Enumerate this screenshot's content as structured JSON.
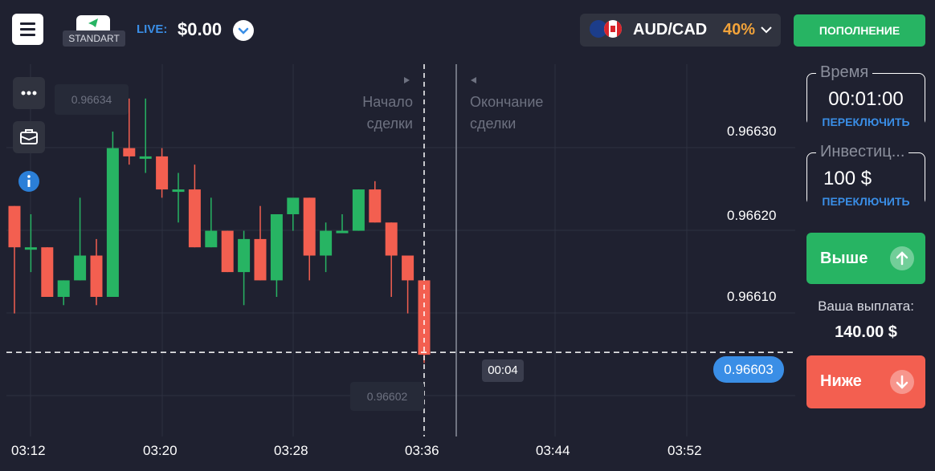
{
  "header": {
    "account_type": "STANDART",
    "live_label": "LIVE:",
    "balance": "$0.00",
    "asset": {
      "pair": "AUD/CAD",
      "payout_percent": "40%"
    },
    "deposit_label": "ПОПОЛНЕНИЕ"
  },
  "chart": {
    "price_labels": [
      "0.96630",
      "0.96620",
      "0.96610"
    ],
    "time_labels": [
      "03:12",
      "03:20",
      "03:28",
      "03:36",
      "03:44",
      "03:52"
    ],
    "high_marker": "0.96634",
    "low_marker": "0.96602",
    "current_price": "0.96603",
    "timer": "00:04",
    "trade_start_label": "Начало сделки",
    "trade_end_label": "Окончание сделки",
    "colors": {
      "up": "#27b463",
      "down": "#f35f50"
    },
    "candles": [
      {
        "o": 0.96621,
        "h": 0.96621,
        "l": 0.96608,
        "c": 0.96616
      },
      {
        "o": 0.96616,
        "h": 0.9662,
        "l": 0.96613,
        "c": 0.96616
      },
      {
        "o": 0.96616,
        "h": 0.96616,
        "l": 0.9661,
        "c": 0.9661
      },
      {
        "o": 0.9661,
        "h": 0.96612,
        "l": 0.96609,
        "c": 0.96612
      },
      {
        "o": 0.96612,
        "h": 0.96622,
        "l": 0.96612,
        "c": 0.96615
      },
      {
        "o": 0.96615,
        "h": 0.96617,
        "l": 0.96609,
        "c": 0.9661
      },
      {
        "o": 0.9661,
        "h": 0.9663,
        "l": 0.9661,
        "c": 0.96628
      },
      {
        "o": 0.96628,
        "h": 0.96634,
        "l": 0.96626,
        "c": 0.96627
      },
      {
        "o": 0.96627,
        "h": 0.96634,
        "l": 0.96625,
        "c": 0.96627
      },
      {
        "o": 0.96627,
        "h": 0.96628,
        "l": 0.96622,
        "c": 0.96623
      },
      {
        "o": 0.96623,
        "h": 0.96625,
        "l": 0.96619,
        "c": 0.96623
      },
      {
        "o": 0.96623,
        "h": 0.96626,
        "l": 0.96616,
        "c": 0.96616
      },
      {
        "o": 0.96616,
        "h": 0.96622,
        "l": 0.96616,
        "c": 0.96618
      },
      {
        "o": 0.96618,
        "h": 0.96618,
        "l": 0.96613,
        "c": 0.96613
      },
      {
        "o": 0.96613,
        "h": 0.96618,
        "l": 0.96609,
        "c": 0.96617
      },
      {
        "o": 0.96617,
        "h": 0.96621,
        "l": 0.96612,
        "c": 0.96612
      },
      {
        "o": 0.96612,
        "h": 0.9662,
        "l": 0.9661,
        "c": 0.9662
      },
      {
        "o": 0.9662,
        "h": 0.9662,
        "l": 0.96618,
        "c": 0.96622
      },
      {
        "o": 0.96622,
        "h": 0.96622,
        "l": 0.96612,
        "c": 0.96615
      },
      {
        "o": 0.96615,
        "h": 0.96619,
        "l": 0.96613,
        "c": 0.96618
      },
      {
        "o": 0.96618,
        "h": 0.9662,
        "l": 0.96618,
        "c": 0.96618
      },
      {
        "o": 0.96618,
        "h": 0.96623,
        "l": 0.96618,
        "c": 0.96623
      },
      {
        "o": 0.96623,
        "h": 0.96624,
        "l": 0.96619,
        "c": 0.96619
      },
      {
        "o": 0.96619,
        "h": 0.96619,
        "l": 0.9661,
        "c": 0.96615
      },
      {
        "o": 0.96615,
        "h": 0.96615,
        "l": 0.96608,
        "c": 0.96612
      },
      {
        "o": 0.96612,
        "h": 0.96612,
        "l": 0.96602,
        "c": 0.96603
      }
    ]
  },
  "panel": {
    "time_caption": "Время",
    "time_value": "00:01:00",
    "switch_label": "ПЕРЕКЛЮЧИТЬ",
    "invest_caption": "Инвестиц...",
    "invest_value": "100 $",
    "up_label": "Выше",
    "down_label": "Ниже",
    "payout_caption": "Ваша выплата:",
    "payout_value": "140.00 $"
  }
}
